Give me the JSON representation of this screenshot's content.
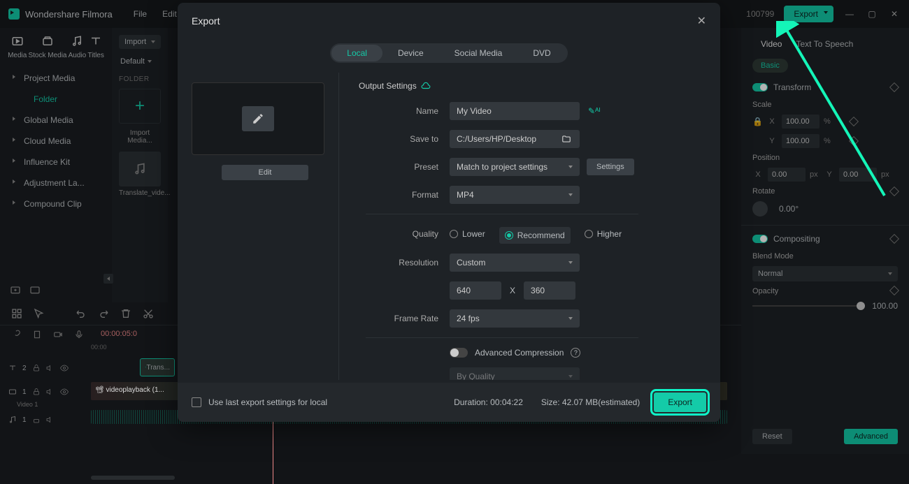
{
  "app": {
    "title": "Wondershare Filmora"
  },
  "menu": {
    "file": "File",
    "edit": "Edit"
  },
  "titlebar": {
    "badge": "100799",
    "export": "Export"
  },
  "tabs": {
    "media": "Media",
    "stock": "Stock Media",
    "audio": "Audio",
    "titles": "Titles"
  },
  "sidebar": {
    "project_media": "Project Media",
    "folder": "Folder",
    "global_media": "Global Media",
    "cloud_media": "Cloud Media",
    "influence_kit": "Influence Kit",
    "adjustment": "Adjustment La...",
    "compound": "Compound Clip"
  },
  "mid": {
    "import": "Import",
    "default": "Default",
    "folder_label": "FOLDER",
    "import_media": "Import Media...",
    "translate": "Translate_vide..."
  },
  "timeline": {
    "time": "00:00:05:0",
    "t0": "00:00",
    "trans_clip": "Trans...",
    "video_clip": "videoplayback (1...",
    "v_track": "Video 1",
    "t_count": "2",
    "v_count": "1",
    "a_count": "1"
  },
  "dialog": {
    "title": "Export",
    "tabs": {
      "local": "Local",
      "device": "Device",
      "social": "Social Media",
      "dvd": "DVD"
    },
    "edit": "Edit",
    "section": "Output Settings",
    "name_label": "Name",
    "name_value": "My Video",
    "save_label": "Save to",
    "save_value": "C:/Users/HP/Desktop",
    "preset_label": "Preset",
    "preset_value": "Match to project settings",
    "settings_btn": "Settings",
    "format_label": "Format",
    "format_value": "MP4",
    "quality_label": "Quality",
    "q_lower": "Lower",
    "q_rec": "Recommend",
    "q_higher": "Higher",
    "res_label": "Resolution",
    "res_value": "Custom",
    "res_w": "640",
    "res_h": "360",
    "res_x": "X",
    "fr_label": "Frame Rate",
    "fr_value": "24 fps",
    "adv_label": "Advanced Compression",
    "bq_value": "By Quality",
    "last_export": "Use last export settings for local",
    "duration_label": "Duration:",
    "duration": "00:04:22",
    "size_label": "Size:",
    "size": "42.07 MB(estimated)",
    "export_btn": "Export"
  },
  "right": {
    "tab_video": "Video",
    "tab_tts": "Text To Speech",
    "basic": "Basic",
    "transform": "Transform",
    "scale": "Scale",
    "x": "X",
    "y": "Y",
    "val100": "100.00",
    "pct": "%",
    "position": "Position",
    "val0": "0.00",
    "px": "px",
    "rotate": "Rotate",
    "rotate_val": "0.00°",
    "compositing": "Compositing",
    "blend": "Blend Mode",
    "normal": "Normal",
    "opacity": "Opacity",
    "op_val": "100.00",
    "reset": "Reset",
    "advanced": "Advanced"
  }
}
